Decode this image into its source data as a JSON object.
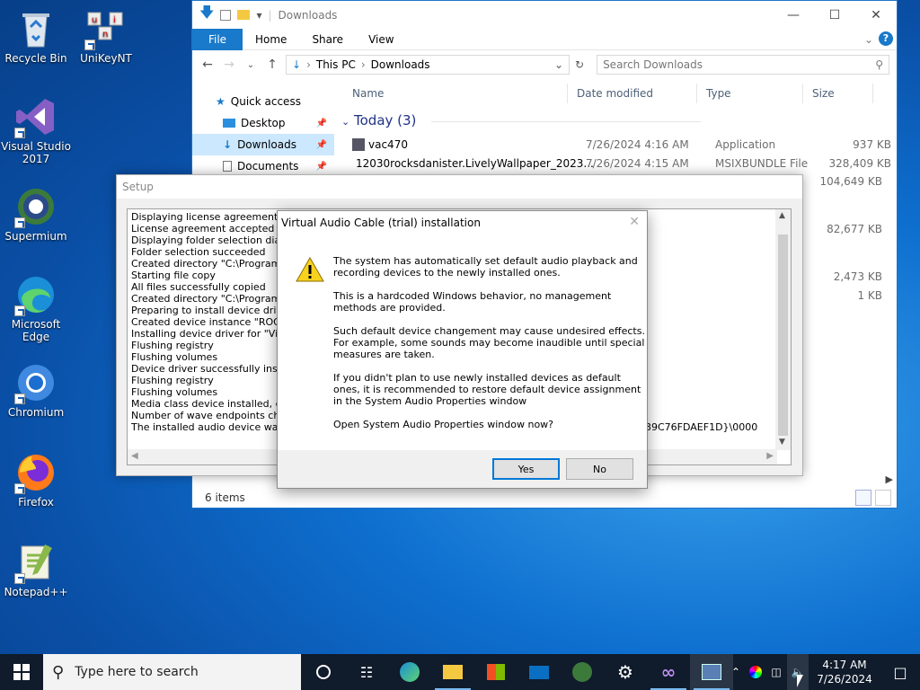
{
  "desktop": {
    "icons": [
      {
        "label": "Recycle Bin"
      },
      {
        "label": "UniKeyNT"
      },
      {
        "label": "Visual Studio 2017"
      },
      {
        "label": "Supermium"
      },
      {
        "label": "Microsoft Edge"
      },
      {
        "label": "Chromium"
      },
      {
        "label": "Firefox"
      },
      {
        "label": "Notepad++"
      }
    ]
  },
  "explorer": {
    "title": "Downloads",
    "ribbon": {
      "file": "File",
      "home": "Home",
      "share": "Share",
      "view": "View"
    },
    "address": {
      "this_pc": "This PC",
      "downloads": "Downloads"
    },
    "search_placeholder": "Search Downloads",
    "nav": {
      "quick_access": "Quick access",
      "desktop": "Desktop",
      "downloads": "Downloads",
      "documents": "Documents"
    },
    "columns": {
      "name": "Name",
      "date": "Date modified",
      "type": "Type",
      "size": "Size"
    },
    "group": "Today (3)",
    "files": [
      {
        "name": "vac470",
        "date": "7/26/2024 4:16 AM",
        "type": "Application",
        "size": "937 KB"
      },
      {
        "name": "12030rocksdanister.LivelyWallpaper_2023...",
        "date": "7/26/2024 4:15 AM",
        "type": "MSIXBUNDLE File",
        "size": "328,409 KB"
      }
    ],
    "extra_sizes": [
      "104,649 KB",
      "82,677 KB",
      "2,473 KB",
      "1 KB"
    ],
    "status": "6 items"
  },
  "setup": {
    "title": "Setup",
    "log": [
      "Displaying license agreement",
      "License agreement accepted",
      "Displaying folder selection dialog",
      "Folder selection succeeded",
      "Created directory \"C:\\Program File",
      "Starting file copy",
      "All files successfully copied",
      "Created directory \"C:\\ProgramDat",
      "Preparing to install device driver f",
      "Created device instance \"ROOT\\{",
      "Installing device driver for \"Virtual",
      "Flushing registry",
      "Flushing volumes",
      "Device driver successfully installed",
      "Flushing registry",
      "Flushing volumes",
      "Media class device installed, check",
      "Number of wave endpoints change",
      "The installed audio device was aut"
    ],
    "log_tail": "39C76FDAEF1D}\\0000"
  },
  "dialog": {
    "title": "Virtual Audio Cable (trial) installation",
    "lines": [
      "The system has automatically set default audio playback and",
      "recording devices to the newly installed ones.",
      "This is a hardcoded Windows behavior, no management",
      "methods are provided.",
      "Such default device changement may cause undesired effects.",
      "For example, some sounds may become inaudible until special",
      "measures are taken.",
      "If you didn't plan to use newly installed devices as default",
      "ones, it is recommended to restore default device assignment",
      "in the System Audio Properties window",
      "Open System Audio Properties window now?"
    ],
    "yes": "Yes",
    "no": "No"
  },
  "taskbar": {
    "search_placeholder": "Type here to search",
    "time": "4:17 AM",
    "date": "7/26/2024"
  }
}
